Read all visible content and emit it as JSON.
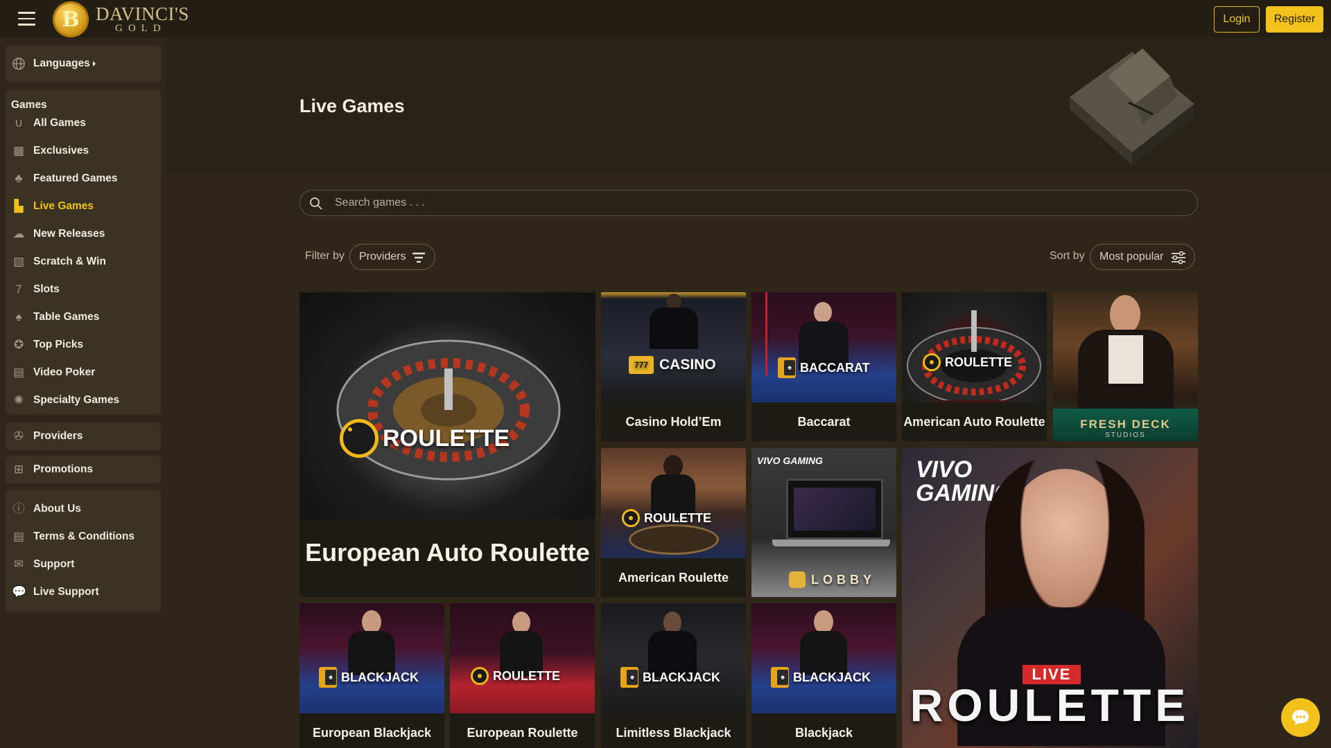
{
  "header": {
    "logo_line1": "DAVINCI'S",
    "logo_line2": "GOLD",
    "logo_mark": "B",
    "login_label": "Login",
    "register_label": "Register"
  },
  "sidebar": {
    "languages_label": "Languages",
    "games_heading": "Games",
    "games": [
      {
        "label": "All Games",
        "icon": "horseshoe-icon"
      },
      {
        "label": "Exclusives",
        "icon": "exclusives-icon"
      },
      {
        "label": "Featured Games",
        "icon": "clover-icon"
      },
      {
        "label": "Live Games",
        "icon": "live-games-icon",
        "active": true
      },
      {
        "label": "New Releases",
        "icon": "new-releases-icon"
      },
      {
        "label": "Scratch & Win",
        "icon": "scratch-icon"
      },
      {
        "label": "Slots",
        "icon": "slots-icon"
      },
      {
        "label": "Table Games",
        "icon": "table-games-icon"
      },
      {
        "label": "Top Picks",
        "icon": "top-picks-icon"
      },
      {
        "label": "Video Poker",
        "icon": "video-poker-icon"
      },
      {
        "label": "Specialty Games",
        "icon": "specialty-icon"
      }
    ],
    "providers_label": "Providers",
    "promotions_label": "Promotions",
    "info": [
      {
        "label": "About Us",
        "icon": "info-icon"
      },
      {
        "label": "Terms & Conditions",
        "icon": "document-icon"
      },
      {
        "label": "Support",
        "icon": "mail-icon"
      },
      {
        "label": "Live Support",
        "icon": "chat-bubble-icon"
      }
    ]
  },
  "main": {
    "title": "Live Games",
    "search_placeholder": "Search games . . .",
    "filter_label": "Filter by",
    "filter_value": "Providers",
    "sort_label": "Sort by",
    "sort_value": "Most popular"
  },
  "tiles": {
    "t1": {
      "caption": "European Auto Roulette",
      "badge": "ROULETTE"
    },
    "t2": {
      "caption": "Casino Hold’Em",
      "badge": "CASINO"
    },
    "t3": {
      "caption": "Baccarat",
      "badge": "BACCARAT"
    },
    "t4": {
      "caption": "American Auto Roulette",
      "badge": "ROULETTE"
    },
    "t5": {
      "brand1": "FRESH DECK",
      "brand2": "STUDIOS"
    },
    "t6": {
      "caption": "American Roulette",
      "badge": "ROULETTE"
    },
    "t7": {
      "brand": "VIVO GAMING",
      "badge": "LOBBY"
    },
    "t8": {
      "brand": "VIVO GAMING",
      "live": "LIVE",
      "badge": "ROULETTE"
    },
    "t9": {
      "caption": "European Blackjack",
      "badge": "BLACKJACK"
    },
    "t10": {
      "caption": "European Roulette",
      "badge": "ROULETTE"
    },
    "t11": {
      "caption": "Limitless Blackjack",
      "badge": "BLACKJACK"
    },
    "t12": {
      "caption": "Blackjack",
      "badge": "BLACKJACK"
    }
  },
  "colors": {
    "accent": "#f2c11b",
    "background": "#2e2719",
    "header": "#241f14"
  }
}
